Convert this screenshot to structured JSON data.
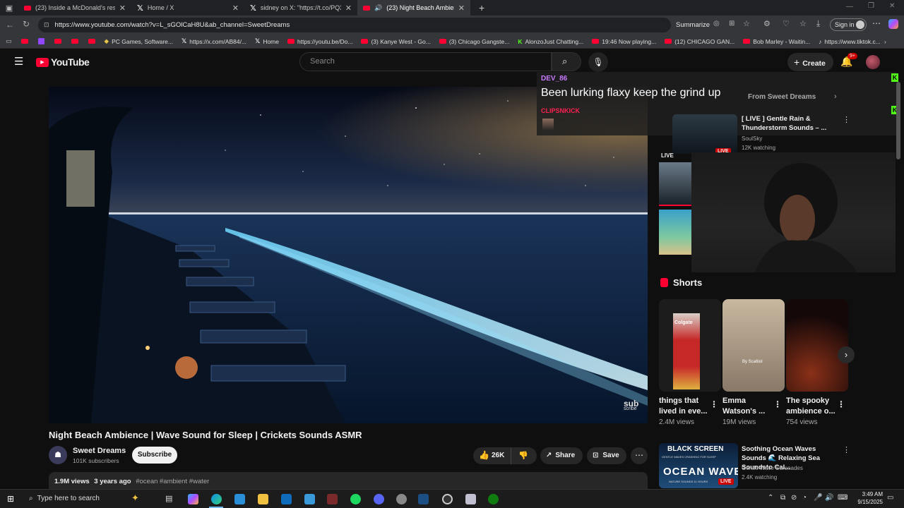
{
  "browser": {
    "tabs": [
      {
        "title": "(23) Inside a McDonald's restaura",
        "favicon": "youtube-icon"
      },
      {
        "title": "Home / X",
        "favicon": "x-icon"
      },
      {
        "title": "sidney on X: \"https://t.co/PQ3uD",
        "favicon": "x-icon"
      },
      {
        "title": "(23) Night Beach Ambience |",
        "favicon": "youtube-icon",
        "active": true
      }
    ],
    "new_tab": "+",
    "url": "https://www.youtube.com/watch?v=L_sGOlCaH8U&ab_channel=SweetDreams",
    "summarize": "Summarize",
    "sign_in": "Sign in",
    "bookmarks": [
      {
        "label": "PC Games, Software...",
        "icon": "games-icon"
      },
      {
        "label": "https://x.com/AB84/...",
        "icon": "x-icon"
      },
      {
        "label": "Home",
        "icon": "x-icon"
      },
      {
        "label": "https://youtu.be/Do...",
        "icon": "youtube-icon"
      },
      {
        "label": "(3) Kanye West - Go...",
        "icon": "youtube-icon"
      },
      {
        "label": "(3) Chicago Gangste...",
        "icon": "youtube-icon"
      },
      {
        "label": "AlonzoJust Chatting...",
        "icon": "kick-icon"
      },
      {
        "label": "19:46 Now playing...",
        "icon": "youtube-icon"
      },
      {
        "label": "(12) CHICAGO GAN...",
        "icon": "youtube-icon"
      },
      {
        "label": "Bob Marley - Waitin...",
        "icon": "youtube-icon"
      },
      {
        "label": "https://www.tiktok.c...",
        "icon": "tiktok-icon"
      }
    ]
  },
  "youtube": {
    "logo": "YouTube",
    "search_placeholder": "Search",
    "create": "Create",
    "notif_badge": "9+",
    "video": {
      "title": "Night Beach Ambience | Wave Sound for Sleep | Crickets Sounds ASMR",
      "channel": "Sweet Dreams",
      "subscribers": "101K subscribers",
      "subscribe": "Subscribe",
      "likes": "26K",
      "share": "Share",
      "save": "Save",
      "views": "1.9M views",
      "age": "3 years ago",
      "tags": "#ocean #ambient #water",
      "watermark_top": "sub",
      "watermark_bottom": "scribe"
    },
    "sidebar": {
      "chip_from": "From Sweet Dreams",
      "rec1": {
        "title": "[ LIVE ] Gentle Rain & Thunderstorm Sounds – ...",
        "channel": "SoulSky",
        "meta": "12K watching",
        "badge": "LIVE"
      },
      "live_label": "LIVE",
      "shorts_heading": "Shorts",
      "shorts": [
        {
          "title": "things that lived in eve...",
          "views": "2.4M views",
          "thumb_text": "Colgate"
        },
        {
          "title": "Emma Watson's ...",
          "views": "19M views",
          "thumb_text": "By Sca6ioI"
        },
        {
          "title": "The spooky ambience o...",
          "views": "754 views",
          "thumb_text": ""
        }
      ],
      "rec2": {
        "title": "Soothing Ocean Waves Sounds 🌊 Relaxing Sea Soundsto Cal...",
        "channel": "Gentle Wave Serenades",
        "meta": "2.4K watching",
        "badge": "LIVE",
        "thumb_top": "BLACK SCREEN",
        "thumb_sub": "GENTLE WAVES CRASHING FOR SLEEP",
        "thumb_main": "OCEAN WAVE",
        "thumb_foot": "NATURE SOUNDS 11 HOURS"
      }
    }
  },
  "stream_overlay": {
    "username": "DEV_86",
    "message": "Been lurking flaxy keep the grind up",
    "username2": "CLIPSNKICK",
    "kick_label": "K"
  },
  "taskbar": {
    "search": "Type here to search",
    "time": "3:49 AM",
    "date": "9/15/2025"
  }
}
